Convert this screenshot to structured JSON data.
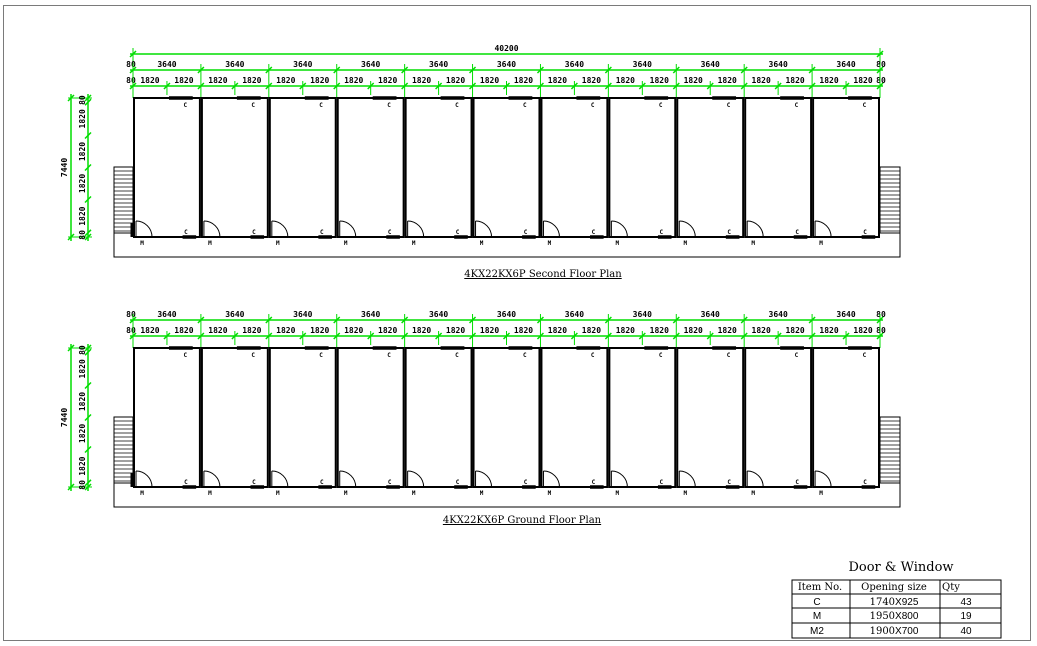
{
  "colors": {
    "dimension": "#00dd00",
    "wall": "#000000",
    "frame": "#7a7a7a"
  },
  "overall_dimension": "40200",
  "module_label": "3640",
  "half_label": "1820",
  "end_label": "80",
  "side_total": "7440",
  "side_segments": [
    "80",
    "1820",
    "1820",
    "1820",
    "1820",
    "80"
  ],
  "window_label": "C",
  "door_label": "M",
  "plans": [
    {
      "title": "4KX22KX6P Second Floor Plan",
      "has_overall": true
    },
    {
      "title": "4KX22KX6P Ground Floor Plan",
      "has_overall": false
    }
  ],
  "schedule": {
    "title": "Door & Window",
    "headers": [
      "Item No.",
      "Opening size",
      "Qty"
    ],
    "rows": [
      {
        "item": "C",
        "size_num": "1740",
        "size_x": "X925",
        "qty": "43"
      },
      {
        "item": "M",
        "size_num": "1950",
        "size_x": "X800",
        "qty": "19"
      },
      {
        "item": "M2",
        "size_num": "1900",
        "size_x": "X700",
        "qty": "40"
      }
    ]
  }
}
